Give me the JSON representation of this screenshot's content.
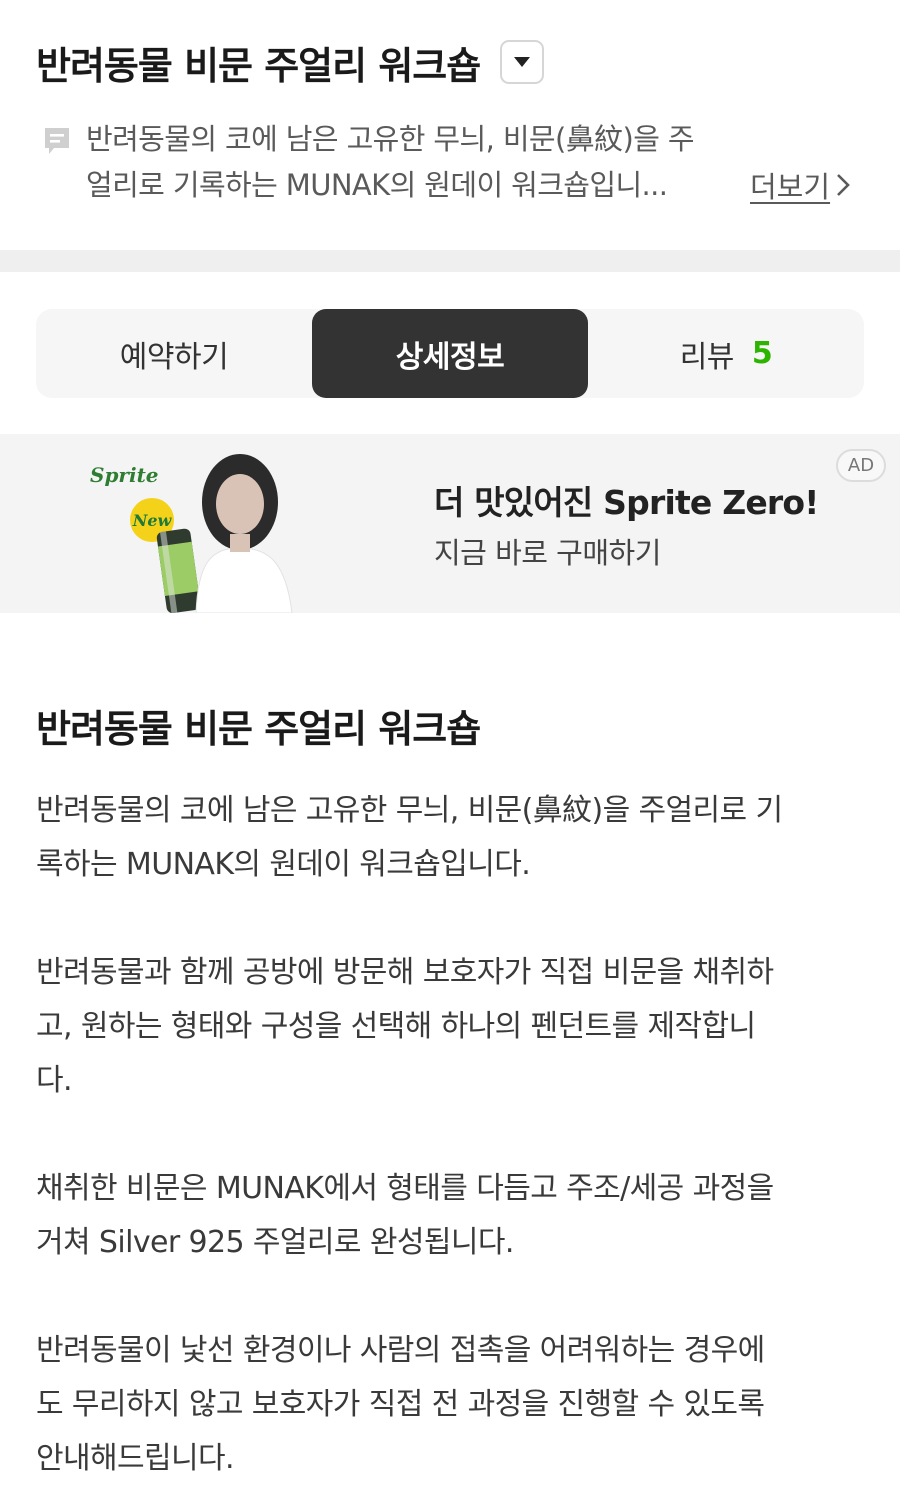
{
  "header": {
    "title": "반려동물 비문 주얼리 워크숍",
    "summary_lines": [
      "반려동물의 코에 남은 고유한 무늬, 비문(鼻紋)을 주",
      "얼리로 기록하는 MUNAK의 원데이 워크숍입니..."
    ],
    "more_label": "더보기",
    "dropdown_icon": "chevron-down-icon",
    "summary_icon": "memo-icon"
  },
  "tabs": [
    {
      "label": "예약하기",
      "active": false
    },
    {
      "label": "상세정보",
      "active": true
    },
    {
      "label": "리뷰",
      "count": "5",
      "active": false
    }
  ],
  "ad": {
    "headline": "더 맛있어진 Sprite Zero!",
    "sub": "지금 바로 구매하기",
    "badge": "AD",
    "brand_logo_text": "Sprite",
    "new_label": "New"
  },
  "detail": {
    "title": "반려동물 비문 주얼리 워크숍",
    "paragraphs": [
      [
        "반려동물의 코에 남은 고유한 무늬, 비문(鼻紋)을 주얼리로 기",
        "록하는 MUNAK의 원데이 워크숍입니다."
      ],
      [
        "반려동물과 함께 공방에 방문해 보호자가 직접 비문을 채취하",
        "고, 원하는 형태와 구성을 선택해 하나의 펜던트를 제작합니",
        "다."
      ],
      [
        "채취한 비문은 MUNAK에서 형태를 다듬고 주조/세공 과정을",
        "거쳐 Silver 925 주얼리로 완성됩니다."
      ],
      [
        "반려동물이 낯선 환경이나 사람의 접촉을 어려워하는 경우에",
        "도 무리하지 않고 보호자가 직접 전 과정을 진행할 수 있도록",
        "안내해드립니다."
      ]
    ]
  },
  "colors": {
    "accent_green": "#2db400",
    "active_tab_bg": "#333333",
    "divider": "#efefef"
  }
}
